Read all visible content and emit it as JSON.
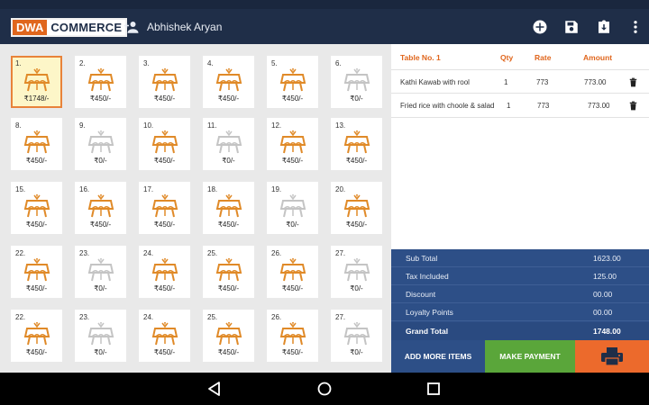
{
  "header": {
    "logo_part1": "DWA",
    "logo_part2": "COMMERCE",
    "user_name": "Abhishek Aryan",
    "icons": [
      "add-person-icon",
      "add-circle-icon",
      "save-icon",
      "download-icon",
      "more-vert-icon"
    ]
  },
  "tables": [
    {
      "num": "1.",
      "price": "₹1748/-",
      "status": "selected"
    },
    {
      "num": "2.",
      "price": "₹450/-",
      "status": "occupied"
    },
    {
      "num": "3.",
      "price": "₹450/-",
      "status": "occupied"
    },
    {
      "num": "4.",
      "price": "₹450/-",
      "status": "occupied"
    },
    {
      "num": "5.",
      "price": "₹450/-",
      "status": "occupied"
    },
    {
      "num": "6.",
      "price": "₹0/-",
      "status": "free"
    },
    {
      "num": "8.",
      "price": "₹450/-",
      "status": "occupied"
    },
    {
      "num": "9.",
      "price": "₹0/-",
      "status": "free"
    },
    {
      "num": "10.",
      "price": "₹450/-",
      "status": "occupied"
    },
    {
      "num": "11.",
      "price": "₹0/-",
      "status": "free"
    },
    {
      "num": "12.",
      "price": "₹450/-",
      "status": "occupied"
    },
    {
      "num": "13.",
      "price": "₹450/-",
      "status": "occupied"
    },
    {
      "num": "15.",
      "price": "₹450/-",
      "status": "occupied"
    },
    {
      "num": "16.",
      "price": "₹450/-",
      "status": "occupied"
    },
    {
      "num": "17.",
      "price": "₹450/-",
      "status": "occupied"
    },
    {
      "num": "18.",
      "price": "₹450/-",
      "status": "occupied"
    },
    {
      "num": "19.",
      "price": "₹0/-",
      "status": "free"
    },
    {
      "num": "20.",
      "price": "₹450/-",
      "status": "occupied"
    },
    {
      "num": "22.",
      "price": "₹450/-",
      "status": "occupied"
    },
    {
      "num": "23.",
      "price": "₹0/-",
      "status": "free"
    },
    {
      "num": "24.",
      "price": "₹450/-",
      "status": "occupied"
    },
    {
      "num": "25.",
      "price": "₹450/-",
      "status": "occupied"
    },
    {
      "num": "26.",
      "price": "₹450/-",
      "status": "occupied"
    },
    {
      "num": "27.",
      "price": "₹0/-",
      "status": "free"
    },
    {
      "num": "22.",
      "price": "₹450/-",
      "status": "occupied"
    },
    {
      "num": "23.",
      "price": "₹0/-",
      "status": "free"
    },
    {
      "num": "24.",
      "price": "₹450/-",
      "status": "occupied"
    },
    {
      "num": "25.",
      "price": "₹450/-",
      "status": "occupied"
    },
    {
      "num": "26.",
      "price": "₹450/-",
      "status": "occupied"
    },
    {
      "num": "27.",
      "price": "₹0/-",
      "status": "free"
    }
  ],
  "order": {
    "headers": {
      "item": "Table No. 1",
      "qty": "Qty",
      "rate": "Rate",
      "amount": "Amount"
    },
    "items": [
      {
        "name": "Kathi Kawab with rool",
        "qty": "1",
        "rate": "773",
        "amount": "773.00"
      },
      {
        "name": "Fried rice with choole  & salad",
        "qty": "1",
        "rate": "773",
        "amount": "773.00"
      }
    ]
  },
  "totals": [
    {
      "label": "Sub Total",
      "value": "1623.00"
    },
    {
      "label": "Tax Included",
      "value": "125.00"
    },
    {
      "label": "Discount",
      "value": "00.00"
    },
    {
      "label": "Loyalty Points",
      "value": "00.00"
    },
    {
      "label": "Grand Total",
      "value": "1748.00"
    }
  ],
  "actions": {
    "add_more": "ADD MORE ITEMS",
    "make_payment": "MAKE PAYMENT",
    "print_icon": "printer-icon"
  },
  "navbar": {
    "icons": [
      "back-icon",
      "home-icon",
      "recents-icon"
    ]
  },
  "colors": {
    "header_bg": "#1f2e48",
    "accent_orange": "#e0661d",
    "occupied_icon": "#e08a28",
    "free_icon": "#c4c4c4",
    "totals_bg": "#2d4f87",
    "pay_green": "#5aa63a",
    "print_orange": "#ec6a2c"
  }
}
